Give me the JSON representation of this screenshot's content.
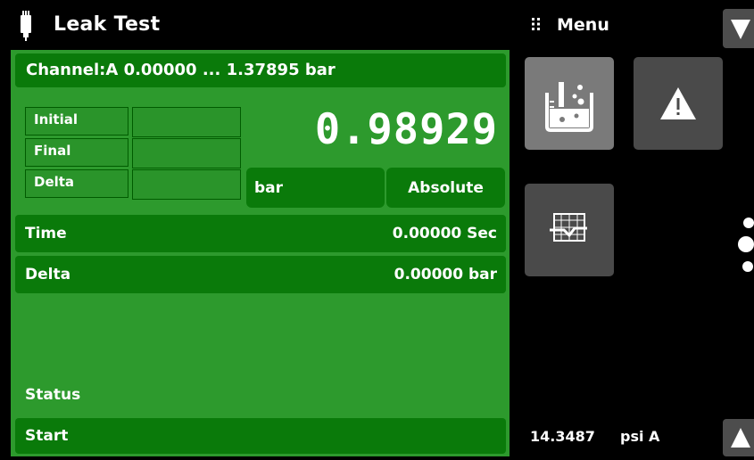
{
  "header": {
    "title": "Leak Test",
    "menu_label": "Menu",
    "app_icon": "transducer-icon",
    "menu_icon": "grip-icon"
  },
  "channel": {
    "label": "Channel:A  0.00000 ... 1.37895 bar"
  },
  "summary_table": {
    "rows": [
      {
        "label": "Initial",
        "value": ""
      },
      {
        "label": "Final",
        "value": ""
      },
      {
        "label": "Delta",
        "value": ""
      }
    ]
  },
  "reading": {
    "value": "0.98929",
    "unit": "bar",
    "mode": "Absolute"
  },
  "time": {
    "label": "Time",
    "value": "0.00000 Sec"
  },
  "delta": {
    "label": "Delta",
    "value": "0.00000 bar"
  },
  "status": {
    "label": "Status"
  },
  "start": {
    "label": "Start"
  },
  "tiles": [
    {
      "name": "leak-test-icon",
      "active": true
    },
    {
      "name": "warning-icon",
      "active": false
    },
    {
      "name": "chart-icon",
      "active": false
    }
  ],
  "barometer": {
    "value": "14.3487",
    "unit": "psi A"
  },
  "colors": {
    "panel_green": "#2d9a2d",
    "row_green": "#0a7a0a",
    "tile_gray": "#4a4a4a",
    "tile_active": "#7a7a7a"
  }
}
